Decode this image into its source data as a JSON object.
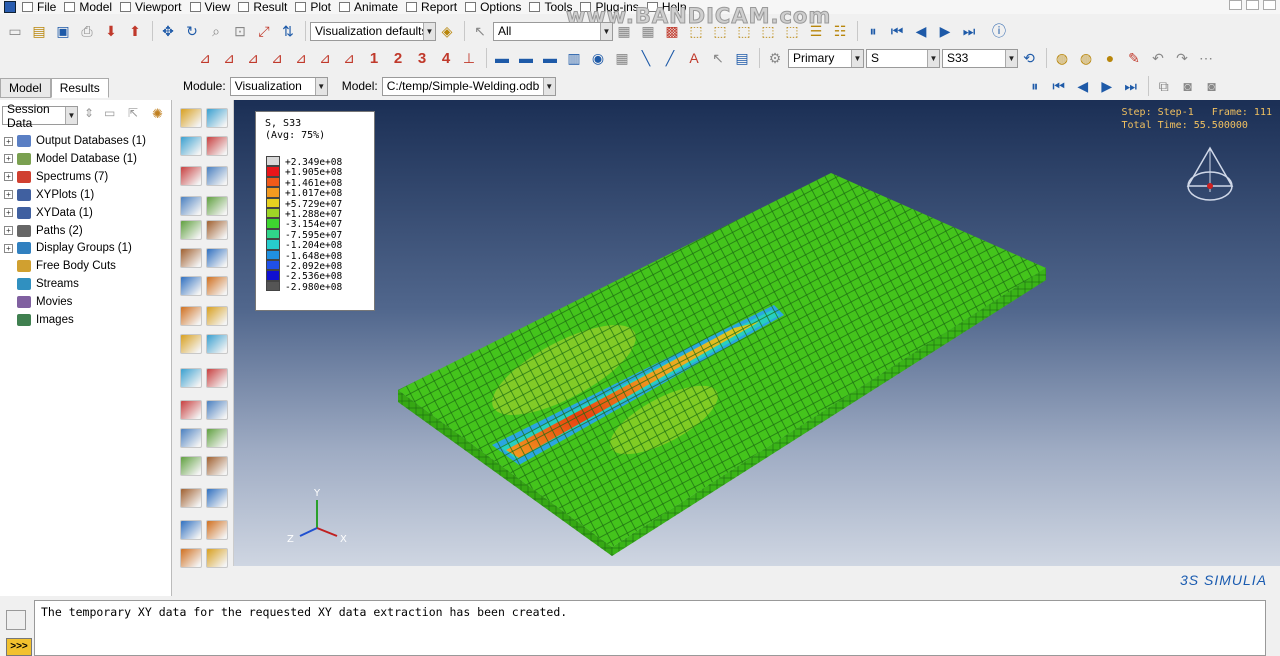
{
  "menu": [
    "File",
    "Model",
    "Viewport",
    "View",
    "Result",
    "Plot",
    "Animate",
    "Report",
    "Options",
    "Tools",
    "Plug-ins",
    "Help"
  ],
  "watermark": "www.BANDICAM.com",
  "toolbar": {
    "view_defaults": "Visualization defaults",
    "selection_filter": "All",
    "render_numbers": [
      "1",
      "2",
      "3",
      "4"
    ],
    "variable_type": "Primary",
    "variable": "S",
    "component": "S33"
  },
  "tabs": {
    "model": "Model",
    "results": "Results"
  },
  "context": {
    "module_label": "Module:",
    "module_value": "Visualization",
    "model_label": "Model:",
    "model_value": "C:/temp/Simple-Welding.odb"
  },
  "session_combo": "Session Data",
  "tree": [
    {
      "label": "Output Databases (1)",
      "expand": true,
      "color": "#5a7fc4"
    },
    {
      "label": "Model Database (1)",
      "expand": true,
      "color": "#7aa050"
    },
    {
      "label": "Spectrums (7)",
      "expand": true,
      "color": "#d04030"
    },
    {
      "label": "XYPlots (1)",
      "expand": true,
      "color": "#4060a0"
    },
    {
      "label": "XYData (1)",
      "expand": true,
      "color": "#4060a0"
    },
    {
      "label": "Paths (2)",
      "expand": true,
      "color": "#666666"
    },
    {
      "label": "Display Groups (1)",
      "expand": true,
      "color": "#3080c0"
    },
    {
      "label": "Free Body Cuts",
      "expand": false,
      "color": "#d0a030"
    },
    {
      "label": "Streams",
      "expand": false,
      "color": "#3090c0"
    },
    {
      "label": "Movies",
      "expand": false,
      "color": "#8060a0"
    },
    {
      "label": "Images",
      "expand": false,
      "color": "#408050"
    }
  ],
  "legend": {
    "title": "S, S33",
    "subtitle": "(Avg: 75%)",
    "values": [
      "+2.349e+08",
      "+1.905e+08",
      "+1.461e+08",
      "+1.017e+08",
      "+5.729e+07",
      "+1.288e+07",
      "-3.154e+07",
      "-7.595e+07",
      "-1.204e+08",
      "-1.648e+08",
      "-2.092e+08",
      "-2.536e+08",
      "-2.980e+08"
    ],
    "colors": [
      "#d8d8d8",
      "#e8151a",
      "#f05a1a",
      "#f39a20",
      "#e6d020",
      "#9ed426",
      "#3ed630",
      "#30d48a",
      "#27cccc",
      "#2090e0",
      "#2050e8",
      "#1010d0",
      "#555555"
    ]
  },
  "step_info": {
    "line1": "Step: Step-1   Frame: 111",
    "line2": "Total Time: 55.500000"
  },
  "triad": {
    "x": "X",
    "y": "Y",
    "z": "Z"
  },
  "brand": "3S SIMULIA",
  "message": "The temporary XY data for the requested XY data extraction has been created.",
  "message_button": ">>>"
}
